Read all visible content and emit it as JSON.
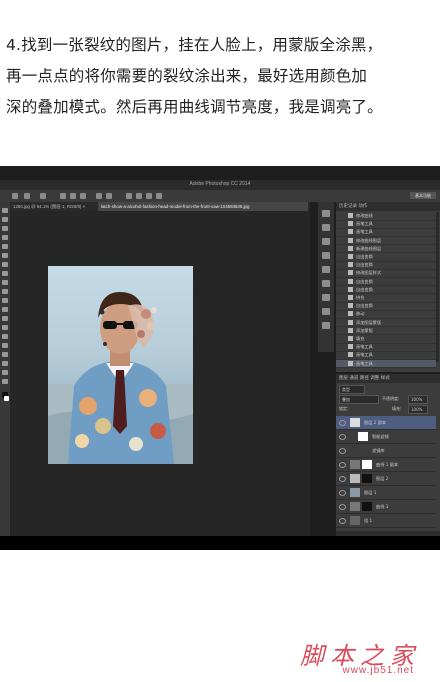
{
  "tutorial": {
    "line1": "4.找到一张裂纹的图片，挂在人脸上，用蒙版全涂黑，",
    "line2": "再一点点的将你需要的裂纹涂出来，最好选用颜色加",
    "line3": "深的叠加模式。然后再用曲线调节亮度，我是调亮了。"
  },
  "photoshop": {
    "title": "Adobe Photoshop CC 2014",
    "workspace": "基本功能",
    "tabs": [
      {
        "label": "1280.jpg @ 94.1% (图层 1, RGB/8) ×"
      },
      {
        "label": "latch-show-a-alcohol-fashion-head-model-from-the-front-vaw-104593635.jpg",
        "active": true
      }
    ],
    "history": {
      "tabs": "历史记录  动作",
      "items": [
        {
          "label": "修改曲线"
        },
        {
          "label": "画笔工具"
        },
        {
          "label": "画笔工具"
        },
        {
          "label": "修改曲线图层"
        },
        {
          "label": "新建曲线图层"
        },
        {
          "label": "自由变换"
        },
        {
          "label": "自由变换"
        },
        {
          "label": "修改图层样式"
        },
        {
          "label": "自由变换"
        },
        {
          "label": "自由变换"
        },
        {
          "label": "拼合"
        },
        {
          "label": "自由变换"
        },
        {
          "label": "移动"
        },
        {
          "label": "添加图层蒙版"
        },
        {
          "label": "添加蒙版"
        },
        {
          "label": "填充"
        },
        {
          "label": "画笔工具"
        },
        {
          "label": "画笔工具"
        },
        {
          "label": "画笔工具",
          "selected": true
        }
      ]
    },
    "layers": {
      "tabs": "图层  通道  路径  调整  样式",
      "kind": "类型",
      "blend_mode": "叠加",
      "opacity_label": "不透明度:",
      "opacity": "100%",
      "fill_label": "填充:",
      "fill": "100%",
      "lock_label": "锁定:",
      "items": [
        {
          "name": "图层 2 副本",
          "selected": true
        },
        {
          "name": "智能滤镜"
        },
        {
          "name": "滤镜库"
        },
        {
          "name": "曲线 1 副本"
        },
        {
          "name": "图层 2"
        },
        {
          "name": "图层 1"
        },
        {
          "name": "曲线 1"
        },
        {
          "name": "组 1"
        }
      ]
    }
  },
  "watermark": {
    "name": "脚本之家",
    "url": "www.jb51.net"
  },
  "colors": {
    "ps_bg": "#1e1e1e",
    "panel": "#3c3c3c",
    "selected": "#4d5e80",
    "watermark": "#d94b5c"
  }
}
